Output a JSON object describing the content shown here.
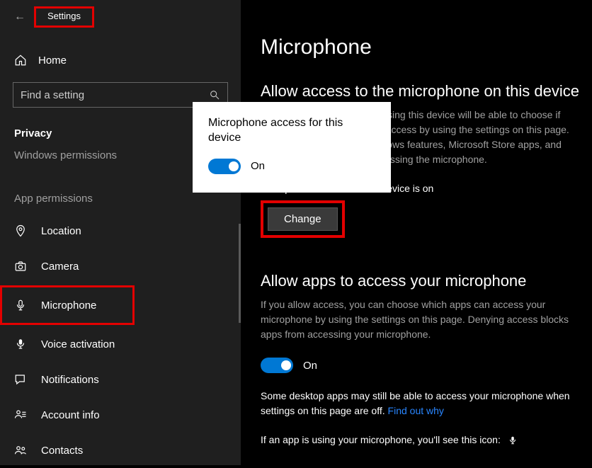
{
  "header": {
    "settings_label": "Settings"
  },
  "sidebar": {
    "home_label": "Home",
    "search_placeholder": "Find a setting",
    "privacy_label": "Privacy",
    "windows_permissions_label": "Windows permissions",
    "app_permissions_label": "App permissions",
    "items": [
      {
        "label": "Location"
      },
      {
        "label": "Camera"
      },
      {
        "label": "Microphone"
      },
      {
        "label": "Voice activation"
      },
      {
        "label": "Notifications"
      },
      {
        "label": "Account info"
      },
      {
        "label": "Contacts"
      }
    ]
  },
  "main": {
    "title": "Microphone",
    "section1_title": "Allow access to the microphone on this device",
    "section1_body": "If you allow access, people using this device will be able to choose if their apps have microphone access by using the settings on this page. Denying access blocks Windows features, Microsoft Store apps, and most desktop apps from accessing the microphone.",
    "section1_status": "Microphone access for this device is on",
    "change_label": "Change",
    "section2_title": "Allow apps to access your microphone",
    "section2_body": "If you allow access, you can choose which apps can access your microphone by using the settings on this page. Denying access blocks apps from accessing your microphone.",
    "toggle_label": "On",
    "section2_note_a": "Some desktop apps may still be able to access your microphone when settings on this page are off. ",
    "section2_note_link": "Find out why",
    "section2_icon_note": "If an app is using your microphone, you'll see this icon:"
  },
  "popup": {
    "title": "Microphone access for this device",
    "toggle_label": "On"
  }
}
